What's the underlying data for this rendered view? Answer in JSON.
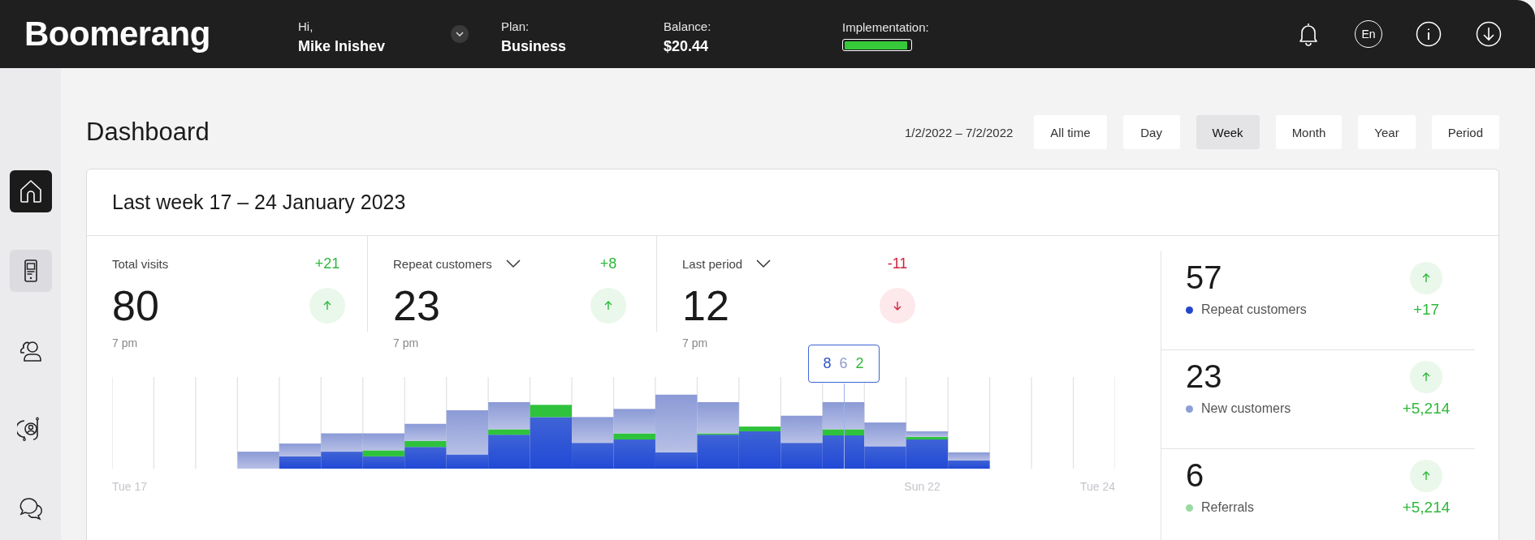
{
  "topbar": {
    "logo": "Boomerang",
    "greeting": "Hi,",
    "user_name": "Mike Inishev",
    "plan_label": "Plan:",
    "plan_value": "Business",
    "balance_label": "Balance:",
    "balance_value": "$20.44",
    "implementation_label": "Implementation:",
    "implementation": {
      "level": 0.96
    },
    "language": "En"
  },
  "sidebar": {
    "items": [
      {
        "kind": "home",
        "selected": true,
        "hovered": false
      },
      {
        "kind": "device",
        "selected": false,
        "hovered": true
      },
      {
        "kind": "users",
        "selected": false,
        "hovered": false
      },
      {
        "kind": "contacts",
        "selected": false,
        "hovered": false
      },
      {
        "kind": "chat",
        "selected": false,
        "hovered": false
      }
    ]
  },
  "page_title": "Dashboard",
  "date_range": "1/2/2022 – 7/2/2022",
  "periods": [
    {
      "label": "All time",
      "selected": false
    },
    {
      "label": "Day",
      "selected": false
    },
    {
      "label": "Week",
      "selected": true
    },
    {
      "label": "Month",
      "selected": false
    },
    {
      "label": "Year",
      "selected": false
    },
    {
      "label": "Period",
      "selected": false
    }
  ],
  "card": {
    "title": "Last week 17 – 24 January 2023",
    "stats": [
      {
        "label": "Total visits",
        "dropdown": false,
        "delta": "+21",
        "kind": "up",
        "value": "80",
        "time": "7 pm"
      },
      {
        "label": "Repeat customers",
        "dropdown": true,
        "delta": "+8",
        "kind": "up",
        "value": "23",
        "time": "7 pm"
      },
      {
        "label": "Last period",
        "dropdown": true,
        "delta": "-11",
        "kind": "down",
        "value": "12",
        "time": "7 pm"
      }
    ],
    "chart": {
      "tooltip": [
        {
          "text": "8",
          "color": "#2f55c9"
        },
        {
          "text": "6",
          "color": "#8d9bc9"
        },
        {
          "text": "2",
          "color": "#2fb83c"
        }
      ],
      "x_labels": [
        "Tue 17",
        "Sun 22",
        "Tue 24"
      ]
    },
    "summary": [
      {
        "value": "57",
        "kind": "up",
        "label": "Repeat customers",
        "color": "#2447c8",
        "change": "+17"
      },
      {
        "value": "23",
        "kind": "up",
        "label": "New customers",
        "color": "#8d9fd3",
        "change": "+5,214"
      },
      {
        "value": "6",
        "kind": "up",
        "label": "Referrals",
        "color": "#9bd9a2",
        "change": "+5,214"
      }
    ]
  }
}
